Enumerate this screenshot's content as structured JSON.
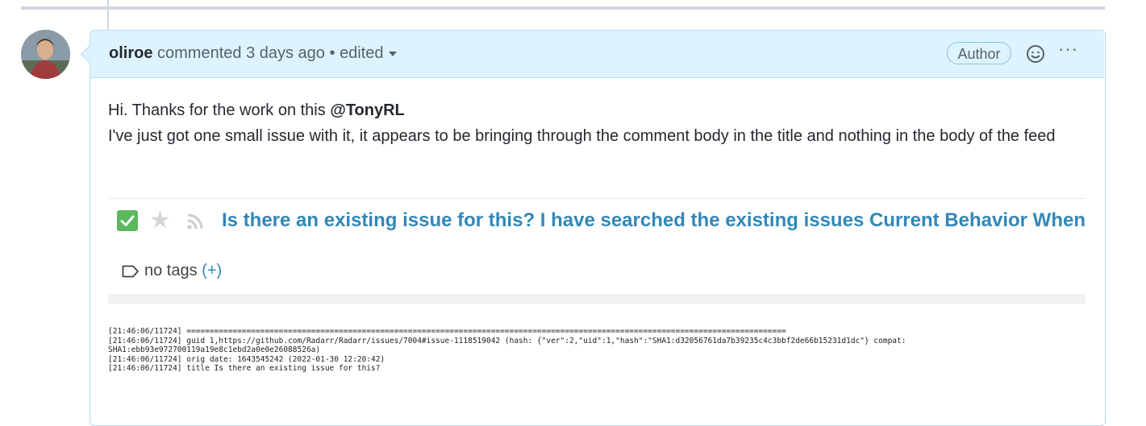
{
  "comment": {
    "author": "oliroe",
    "meta_text": "commented 3 days ago",
    "separator": "•",
    "edited_label": "edited",
    "badge": "Author",
    "more_label": "···",
    "body": {
      "line1_text": "Hi. Thanks for the work on this ",
      "mention": "@TonyRL",
      "line2": "I've just got one small issue with it, it appears to be bringing through the comment body in the title and nothing in the body of the feed"
    }
  },
  "embed": {
    "feed_title": "Is there an existing issue for this? I have searched the existing issues Current Behavior When in",
    "tags_label": "no tags",
    "tags_add": "(+)",
    "log_lines": [
      "[21:46:06/11724] ==================================================================================================================================",
      "[21:46:06/11724] guid 1,https://github.com/Radarr/Radarr/issues/7004#issue-1118519042 (hash: {\"ver\":2,\"uid\":1,\"hash\":\"SHA1:d32056761da7b39235c4c3bbf2de66b15231d1dc\"} compat:",
      "SHA1:ebb93e972700119a19e8c1ebd2a0e0e26088526a)",
      "[21:46:06/11724] orig date: 1643545242 (2022-01-30 12:20:42)",
      "[21:46:06/11724] title Is there an existing issue for this?"
    ]
  },
  "icons": {
    "avatar": "user-avatar",
    "caret": "chevron-down-icon",
    "emoji": "smiley-icon",
    "check": "checkbox-checked-icon",
    "star": "star-icon",
    "rss": "rss-icon",
    "tag": "tag-icon"
  },
  "colors": {
    "header_bg": "#ddf4ff",
    "border": "#b6dbf2",
    "link": "#3287b8",
    "check": "#5cb85c"
  }
}
